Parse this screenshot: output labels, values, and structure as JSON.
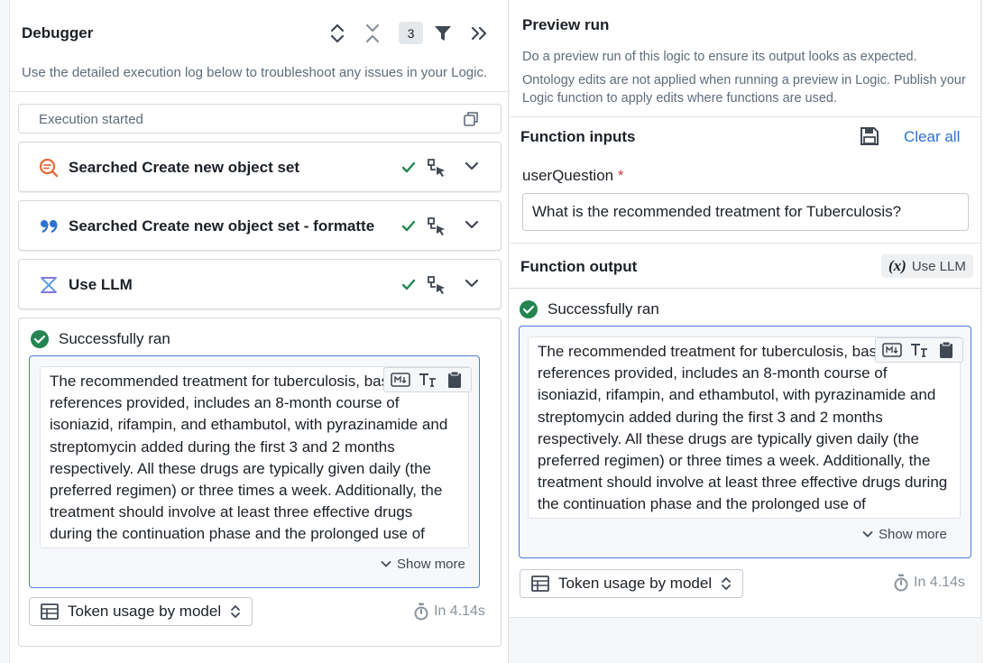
{
  "debugger": {
    "title": "Debugger",
    "description": "Use the detailed execution log below to troubleshoot any issues in your Logic.",
    "filter_count": "3",
    "execution_label": "Execution started",
    "steps": [
      {
        "label": "Searched Create new object set",
        "icon": "search-icon",
        "status": "success"
      },
      {
        "label": "Searched Create new object set - formatte",
        "icon": "quote-icon",
        "status": "success"
      },
      {
        "label": "Use LLM",
        "icon": "llm-icon",
        "status": "success"
      }
    ],
    "result": {
      "status": "Successfully ran",
      "output_text": "The recommended treatment for tuberculosis, based on the references provided, includes an 8-month course of isoniazid, rifampin, and ethambutol, with pyrazinamide and streptomycin added during the first 3 and 2 months respectively. All these drugs are typically given daily (the preferred regimen) or three times a week. Additionally, the treatment should involve at least three effective drugs during the continuation phase and the prolonged use of",
      "show_more": "Show more",
      "token_usage_label": "Token usage by model",
      "timing": "In 4.14s"
    }
  },
  "preview": {
    "title": "Preview run",
    "description_1": "Do a preview run of this logic to ensure its output looks as expected.",
    "description_2": "Ontology edits are not applied when running a preview in Logic. Publish your Logic function to apply edits where functions are used.",
    "inputs_title": "Function inputs",
    "clear_all": "Clear all",
    "field_label": "userQuestion",
    "field_required_mark": "*",
    "field_value": "What is the recommended treatment for Tuberculosis?",
    "output_title": "Function output",
    "output_source_icon": "(x)",
    "output_source": "Use LLM",
    "result": {
      "status": "Successfully ran",
      "output_text": "The recommended treatment for tuberculosis, based on the references provided, includes an 8-month course of isoniazid, rifampin, and ethambutol, with pyrazinamide and streptomycin added during the first 3 and 2 months respectively. All these drugs are typically given daily (the preferred regimen) or three times a week. Additionally, the treatment should involve at least three effective drugs during the continuation phase and the prolonged use of",
      "show_more": "Show more",
      "token_usage_label": "Token usage by model",
      "timing": "In 4.14s"
    }
  },
  "colors": {
    "success": "#238551",
    "link": "#2d72d2",
    "output_border": "#4c7fd4",
    "search_icon": "#e76a3a",
    "quote_icon": "#2d72d2",
    "llm_icon": "#7961db"
  }
}
